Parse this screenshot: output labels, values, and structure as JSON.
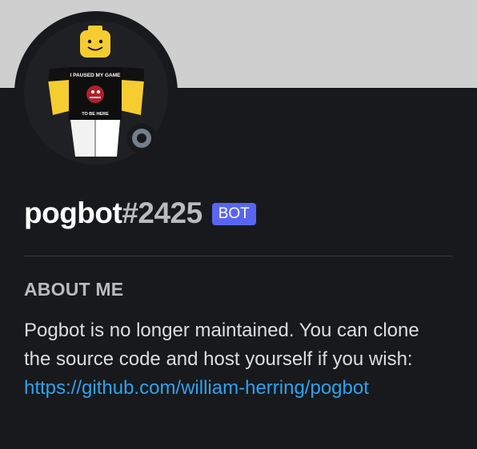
{
  "profile": {
    "username": "pogbot",
    "discriminator": "#2425",
    "badge": "BOT",
    "status": "offline",
    "avatar": {
      "description": "roblox character avatar",
      "shirt_text_top": "I PAUSED MY GAME",
      "shirt_text_bottom": "TO BE HERE"
    }
  },
  "about": {
    "title": "ABOUT ME",
    "text": "Pogbot is no longer maintained. You can clone the source code and host yourself if you wish: ",
    "link_text": "https://github.com/william-herring/pogbot"
  },
  "colors": {
    "banner": "#cfcfcf",
    "background": "#18191c",
    "badge": "#5865f2",
    "link": "#2ba3f1",
    "status_offline": "#747f8d"
  }
}
